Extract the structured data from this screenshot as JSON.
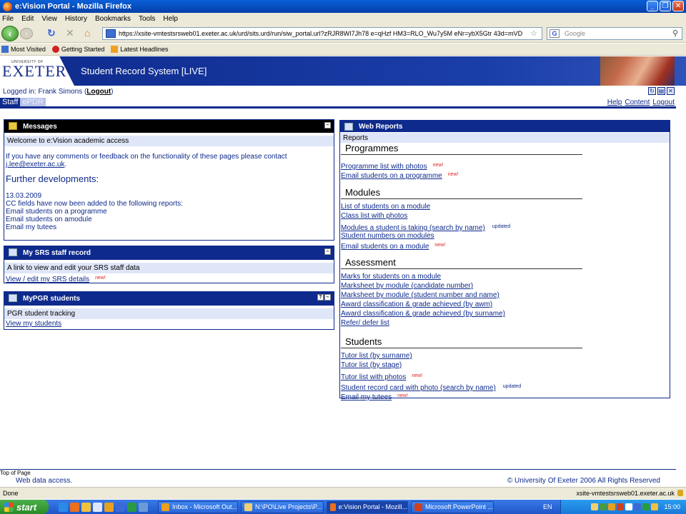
{
  "window": {
    "title": "e:Vision Portal - Mozilla Firefox"
  },
  "menu": [
    "File",
    "Edit",
    "View",
    "History",
    "Bookmarks",
    "Tools",
    "Help"
  ],
  "toolbar": {
    "url": "https://xsite-vmtestsrsweb01.exeter.ac.uk/urd/sits.urd/run/siw_portal.url?zRJR8WI7Jh78 e=qHzf HM3=RLO_Wu7y5M eNr=ybX5Gtr 43d=mVD",
    "search_placeholder": "Google"
  },
  "bookmarks": [
    "Most Visited",
    "Getting Started",
    "Latest Headlines"
  ],
  "header": {
    "logo_small": "UNIVERSITY OF",
    "logo_main": "EXETER",
    "system_title": "Student Record System [LIVE]"
  },
  "user": {
    "logged_in_label": "Logged in:",
    "name": "Frank Simons",
    "logout": "Logout"
  },
  "tabs": [
    "Staff",
    "ePDR"
  ],
  "top_links": [
    "Help",
    "Content",
    "Logout"
  ],
  "messages": {
    "title": "Messages",
    "welcome": "Welcome to e:Vision academic access",
    "feedback": "If you have any comments or feedback on the functionality of these pages please contact",
    "email": "j.lee@exeter.ac.uk",
    "further_heading": "Further developments:",
    "date": "13.03.2009",
    "note": "CC fields have now been added to the following reports:",
    "items": [
      "Email students on a programme",
      "Email students on amodule",
      "Email my tutees"
    ]
  },
  "srs_record": {
    "title": "My SRS staff record",
    "description": "A link to view and edit your SRS staff data",
    "link": "View / edit my SRS details",
    "badge": "new!"
  },
  "pgr": {
    "title": "MyPGR students",
    "description": "PGR student tracking",
    "link": "View my students"
  },
  "web_reports": {
    "title": "Web Reports",
    "subhead": "Reports",
    "sections": [
      {
        "heading": "Programmes",
        "links": [
          {
            "label": "Programme list with photos",
            "badge": "new!"
          },
          {
            "label": "Email students on a programme",
            "badge": "new!"
          }
        ]
      },
      {
        "heading": "Modules",
        "links": [
          {
            "label": "List of students on a module",
            "badge": ""
          },
          {
            "label": "Class list with photos",
            "badge": ""
          },
          {
            "label": "Modules a student is taking (search by name)",
            "badge": "updated"
          },
          {
            "label": "Student numbers on modules",
            "badge": ""
          },
          {
            "label": "Email students on a module",
            "badge": "new!"
          }
        ]
      },
      {
        "heading": "Assessment",
        "links": [
          {
            "label": "Marks for students on a module",
            "badge": ""
          },
          {
            "label": "Marksheet by module (candidate number)",
            "badge": ""
          },
          {
            "label": "Marksheet by module (student number and name)",
            "badge": ""
          },
          {
            "label": "Award classification & grade achieved (by awm)",
            "badge": ""
          },
          {
            "label": "Award classification & grade achieved (by surname)",
            "badge": ""
          },
          {
            "label": "Refer/ defer list",
            "badge": ""
          }
        ]
      },
      {
        "heading": "Students",
        "links": [
          {
            "label": "Tutor list (by surname)",
            "badge": ""
          },
          {
            "label": "Tutor list (by stage)",
            "badge": ""
          },
          {
            "label": "Tutor list with photos",
            "badge": "new!"
          },
          {
            "label": "Student record card with photo (search by name)",
            "badge": "updated"
          },
          {
            "label": "Email my tutees",
            "badge": "new!"
          }
        ]
      }
    ]
  },
  "footer": {
    "top_of_page": "Top of Page",
    "left": "Web data access.",
    "right": "© University Of Exeter 2006 All Rights Reserved"
  },
  "status": {
    "left": "Done",
    "right": "xsite-vmtestsrsweb01.exeter.ac.uk"
  },
  "taskbar": {
    "start": "start",
    "tasks": [
      {
        "label": "Inbox - Microsoft Out...",
        "color": "#e8a020"
      },
      {
        "label": "N:\\PO\\Live Projects\\P...",
        "color": "#f0d070"
      },
      {
        "label": "e:Vision Portal - Mozill...",
        "color": "#e87020"
      },
      {
        "label": "Microsoft PowerPoint ...",
        "color": "#d04020"
      }
    ],
    "lang": "EN",
    "clock": "15:00"
  },
  "colors": {
    "brand_blue": "#0e2a8c",
    "new_red": "#e02020"
  }
}
